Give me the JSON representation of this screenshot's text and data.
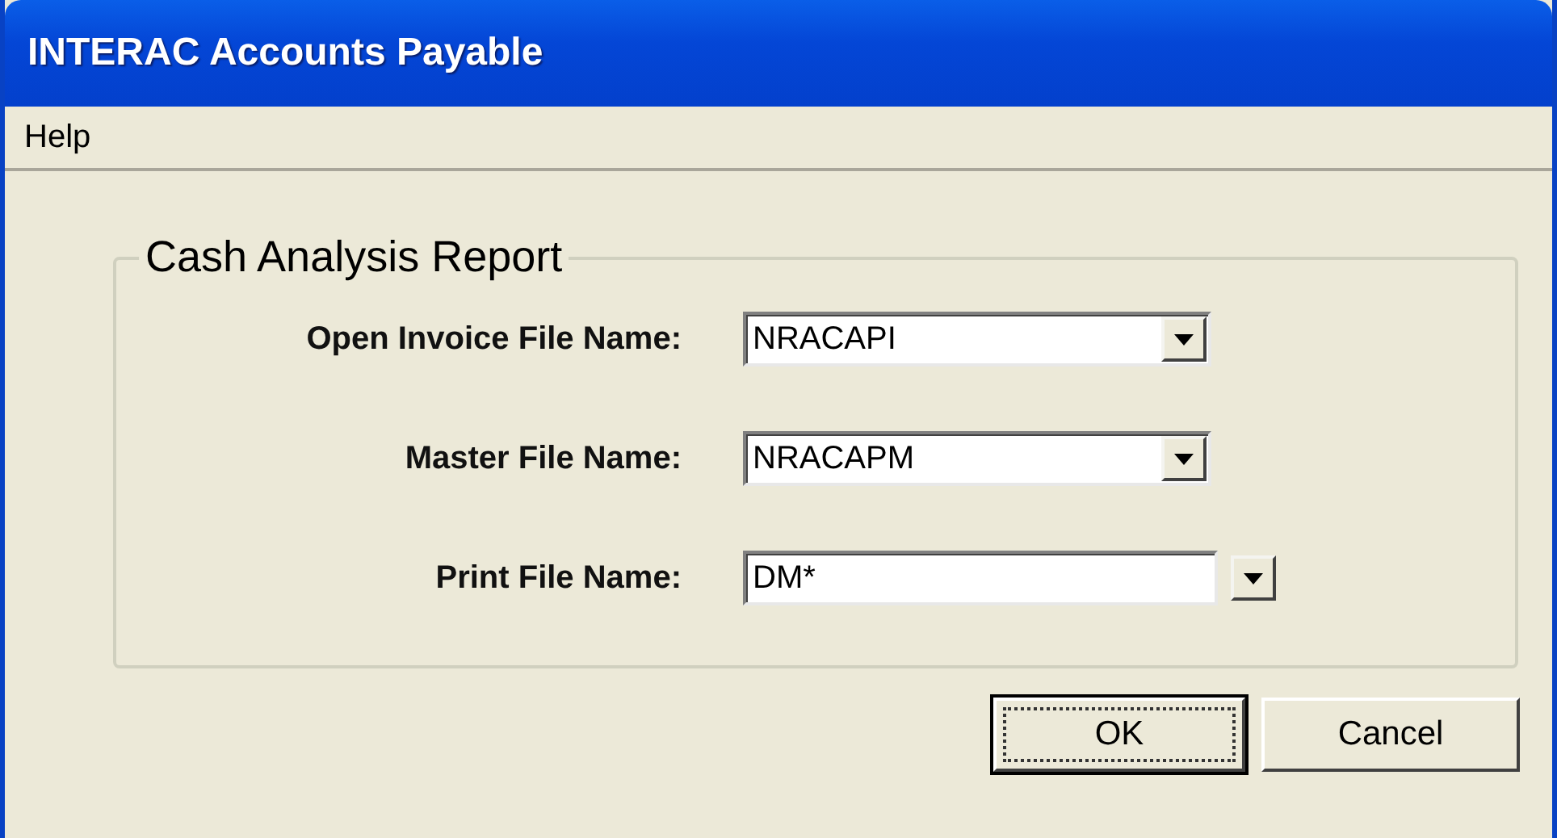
{
  "window": {
    "title": "INTERAC Accounts Payable"
  },
  "menu": [
    "Help"
  ],
  "group": {
    "title": "Cash Analysis Report",
    "fields": [
      {
        "label": "Open Invoice File Name:",
        "value": "NRACAPI",
        "kind": "attached"
      },
      {
        "label": "Master File Name:",
        "value": "NRACAPM",
        "kind": "attached"
      },
      {
        "label": "Print File Name:",
        "value": "DM*",
        "kind": "detached"
      }
    ]
  },
  "buttons": [
    {
      "label": "OK",
      "focused": true
    },
    {
      "label": "Cancel",
      "focused": false
    }
  ]
}
